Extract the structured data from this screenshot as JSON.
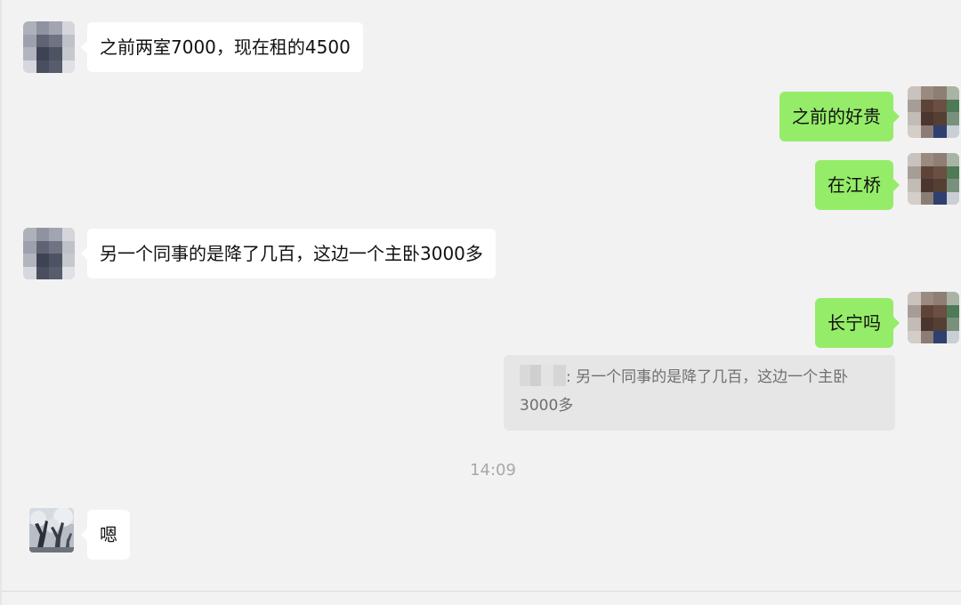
{
  "messages": [
    {
      "side": "in",
      "text": "之前两室7000，现在租的4500"
    },
    {
      "side": "out",
      "text": "之前的好贵"
    },
    {
      "side": "out",
      "text": "在江桥"
    },
    {
      "side": "in",
      "text": "另一个同事的是降了几百，这边一个主卧3000多"
    },
    {
      "side": "out",
      "text": "长宁吗"
    },
    {
      "side": "in",
      "text": "嗯"
    }
  ],
  "quote": {
    "separator": ": ",
    "text": "另一个同事的是降了几百，这边一个主卧3000多"
  },
  "timestamp": "14:09",
  "avatars": {
    "contact": "pixelated-avatar",
    "self": "pixelated-avatar",
    "photo": "tree-photo-avatar"
  },
  "colors": {
    "background": "#f2f2f2",
    "incoming_bubble": "#ffffff",
    "outgoing_bubble": "#95ec69",
    "quote_background": "#e6e6e6"
  }
}
